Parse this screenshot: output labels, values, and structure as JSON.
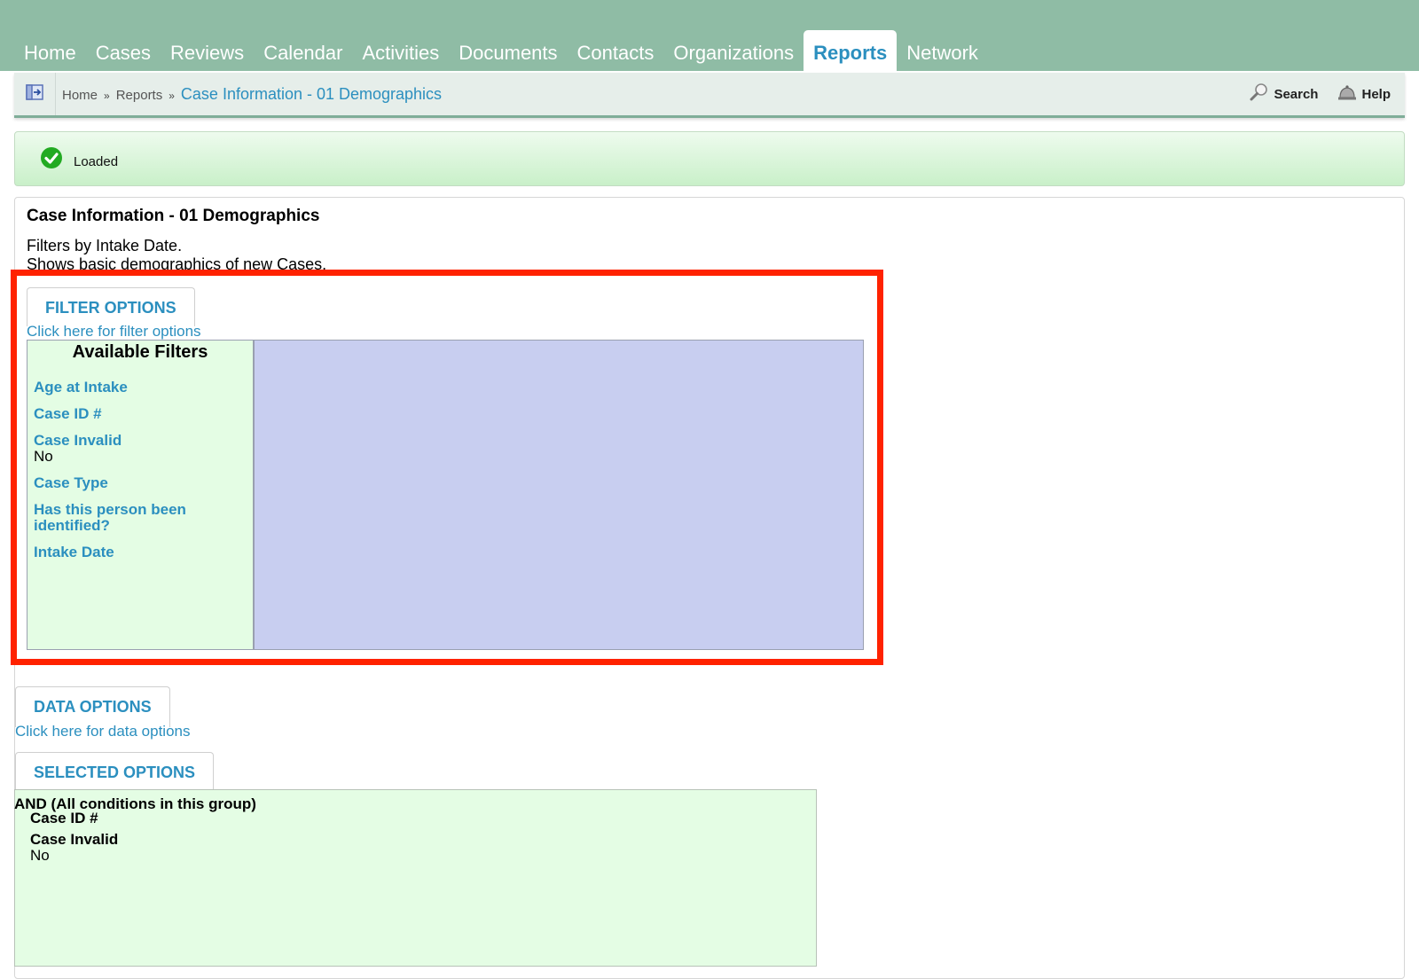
{
  "nav": {
    "tabs": [
      {
        "label": "Home"
      },
      {
        "label": "Cases"
      },
      {
        "label": "Reviews"
      },
      {
        "label": "Calendar"
      },
      {
        "label": "Activities"
      },
      {
        "label": "Documents"
      },
      {
        "label": "Contacts"
      },
      {
        "label": "Organizations"
      },
      {
        "label": "Reports",
        "active": true
      },
      {
        "label": "Network"
      }
    ]
  },
  "breadcrumb": {
    "home": "Home",
    "sep": "»",
    "reports": "Reports",
    "current": "Case Information - 01 Demographics"
  },
  "tools": {
    "search": "Search",
    "help": "Help"
  },
  "status": {
    "message": "Loaded",
    "color": "#22aa22"
  },
  "report": {
    "title": "Case Information - 01 Demographics",
    "desc_line1": "Filters by Intake Date.",
    "desc_line2": "Shows basic demographics of new Cases."
  },
  "filter_options": {
    "tab_label": "FILTER OPTIONS",
    "link": "Click here for filter options",
    "heading": "Available Filters",
    "items": [
      {
        "name": "Age at Intake",
        "value": ""
      },
      {
        "name": "Case ID #",
        "value": ""
      },
      {
        "name": "Case Invalid",
        "value": "No"
      },
      {
        "name": "Case Type",
        "value": ""
      },
      {
        "name": "Has this person been identified?",
        "value": ""
      },
      {
        "name": "Intake Date",
        "value": ""
      }
    ]
  },
  "data_options": {
    "tab_label": "DATA OPTIONS",
    "link": "Click here for data options"
  },
  "selected_options": {
    "tab_label": "SELECTED OPTIONS",
    "group": "AND (All conditions in this group)",
    "items": [
      {
        "name": "Case ID #",
        "value": ""
      },
      {
        "name": "Case Invalid",
        "value": "No"
      }
    ]
  },
  "colors": {
    "nav_bg": "#8fbca5",
    "link": "#2b8fbf",
    "filter_list_bg": "#e4fde4",
    "filter_area_bg": "#c8cef0",
    "highlight": "#ff2200"
  }
}
